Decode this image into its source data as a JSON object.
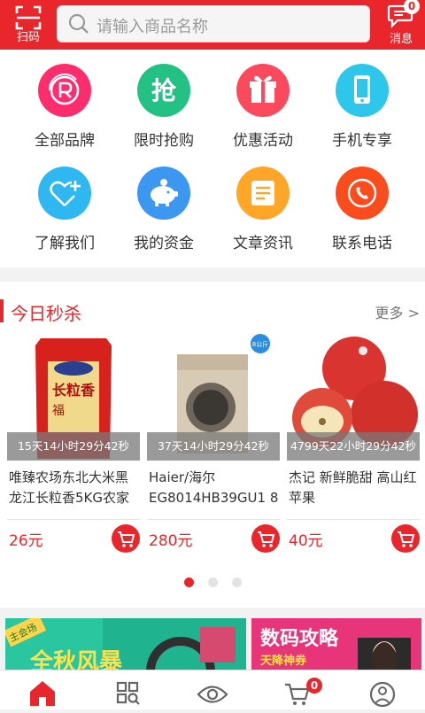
{
  "header": {
    "scan_label": "扫码",
    "search_placeholder": "请输入商品名称",
    "message_label": "消息",
    "message_badge": "0"
  },
  "quick_menu": [
    {
      "label": "全部品牌",
      "icon": "brand-r-icon",
      "color": "#ff2d6e"
    },
    {
      "label": "限时抢购",
      "icon": "flash-sale-icon",
      "color": "#23c184"
    },
    {
      "label": "优惠活动",
      "icon": "gift-icon",
      "color": "#fb4a5e"
    },
    {
      "label": "手机专享",
      "icon": "phone-icon",
      "color": "#2ec6ea"
    },
    {
      "label": "了解我们",
      "icon": "heart-plus-icon",
      "color": "#2eb7f1"
    },
    {
      "label": "我的资金",
      "icon": "piggy-bank-icon",
      "color": "#3b97f0"
    },
    {
      "label": "文章资讯",
      "icon": "article-icon",
      "color": "#ffa629"
    },
    {
      "label": "联系电话",
      "icon": "phone-call-icon",
      "color": "#fb4c1e"
    }
  ],
  "flash_sale": {
    "title": "今日秒杀",
    "more": "更多 >",
    "products": [
      {
        "timer": "15天14小时29分42秒",
        "name": "唯臻农场东北大米黑龙江长粒香5KG农家",
        "price": "26元"
      },
      {
        "timer": "37天14小时29分42秒",
        "name": "Haier/海尔EG8014HB39GU1 8",
        "price": "280元",
        "tag": "8公斤"
      },
      {
        "timer": "4799天22小时29分42秒",
        "name": "杰记 新鲜脆甜 高山红苹果",
        "price": "40元"
      }
    ],
    "page_count": 3,
    "active_page": 1
  },
  "banners": [
    {
      "tag": "主会场",
      "text": "全秋风暴"
    },
    {
      "text": "数码攻略",
      "sub": "天降神券"
    }
  ],
  "tabbar": {
    "items": [
      "home-icon",
      "category-icon",
      "eye-icon",
      "cart-icon",
      "user-icon"
    ],
    "cart_badge": "0"
  }
}
